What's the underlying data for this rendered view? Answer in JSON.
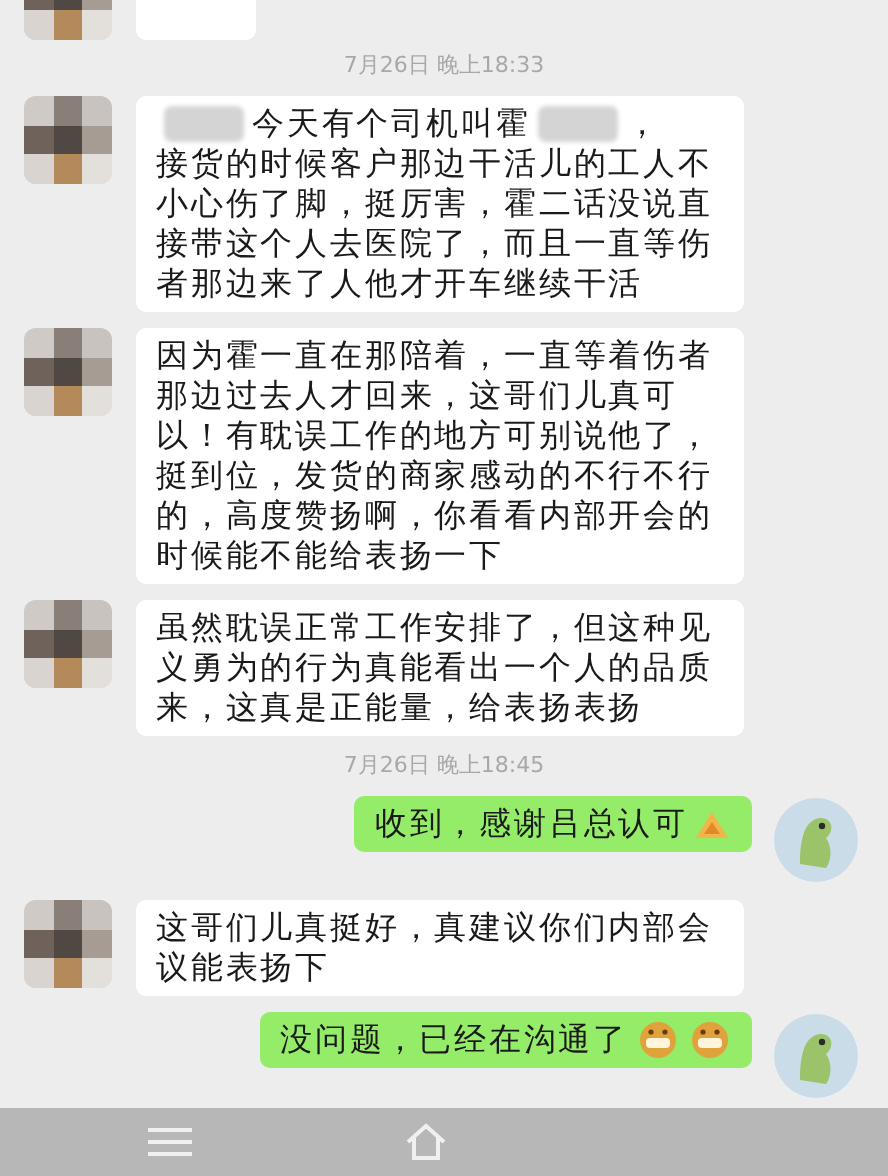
{
  "messages": [
    {
      "kind": "time",
      "text": "7月26日 晚上18:33"
    },
    {
      "kind": "left",
      "lead": [
        {
          "kind": "redacted"
        },
        {
          "kind": "text",
          "text": "今天有个司机叫霍"
        },
        {
          "kind": "redacted"
        },
        {
          "kind": "text",
          "text": "，"
        }
      ],
      "text": "接货的时候客户那边干活儿的工人不小心伤了脚，挺厉害，霍二话没说直接带这个人去医院了，而且一直等伤者那边来了人他才开车继续干活"
    },
    {
      "kind": "left",
      "text": "因为霍一直在那陪着，一直等着伤者那边过去人才回来，这哥们儿真可以！有耽误工作的地方可别说他了，挺到位，发货的商家感动的不行不行的，高度赞扬啊，你看看内部开会的时候能不能给表扬一下"
    },
    {
      "kind": "left",
      "text": "虽然耽误正常工作安排了，但这种见义勇为的行为真能看出一个人的品质来，这真是正能量，给表扬表扬"
    },
    {
      "kind": "time",
      "text": "7月26日 晚上18:45"
    },
    {
      "kind": "right",
      "text": "收到，感谢吕总认可",
      "icons": [
        {
          "kind": "hands"
        }
      ]
    },
    {
      "kind": "left",
      "text": "这哥们儿真挺好，真建议你们内部会议能表扬下"
    },
    {
      "kind": "right",
      "text": "没问题，已经在沟通了",
      "icons": [
        {
          "kind": "grin"
        },
        {
          "kind": "grin"
        }
      ]
    }
  ]
}
